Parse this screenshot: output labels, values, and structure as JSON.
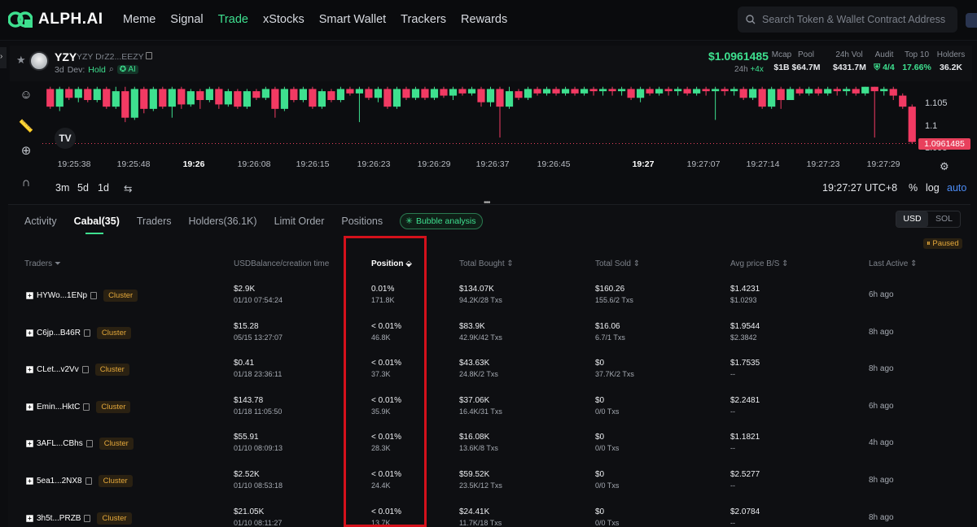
{
  "nav": {
    "logo_text": "ALPH.AI",
    "items": [
      "Meme",
      "Signal",
      "Trade",
      "xStocks",
      "Smart Wallet",
      "Trackers",
      "Rewards"
    ],
    "active_index": 2,
    "search_placeholder": "Search Token & Wallet Contract Address",
    "accent": "#3ee08f"
  },
  "token": {
    "symbol": "YZY",
    "sub_symbol": "YZY",
    "address": "DrZ2...EEZY",
    "age": "3d",
    "dev_label": "Dev:",
    "dev_status": "Hold",
    "ai_label": "AI",
    "price": "$1.0961485",
    "price_period": "24h",
    "price_change": "+4x",
    "stats": [
      {
        "label": "Mcap",
        "value": "$1B"
      },
      {
        "label": "Pool",
        "value": "$64.7M"
      },
      {
        "label": "24h Vol",
        "value": "$431.7M"
      },
      {
        "label": "Audit",
        "value": "4/4"
      },
      {
        "label": "Top 10",
        "value": "17.66%"
      },
      {
        "label": "Holders",
        "value": "36.2K"
      }
    ]
  },
  "chart_data": {
    "type": "candlestick",
    "price_axis_labels": [
      "1.105",
      "1.1",
      "1.095"
    ],
    "current_price_label": "1.0961485",
    "time_labels": [
      {
        "text": "19:25:38",
        "bold": false
      },
      {
        "text": "19:25:48",
        "bold": false
      },
      {
        "text": "19:26",
        "bold": true
      },
      {
        "text": "19:26:08",
        "bold": false
      },
      {
        "text": "19:26:15",
        "bold": false
      },
      {
        "text": "19:26:23",
        "bold": false
      },
      {
        "text": "19:26:29",
        "bold": false
      },
      {
        "text": "19:26:37",
        "bold": false
      },
      {
        "text": "19:26:45",
        "bold": false
      },
      {
        "text": "19:27",
        "bold": true
      },
      {
        "text": "19:27:07",
        "bold": false
      },
      {
        "text": "19:27:14",
        "bold": false
      },
      {
        "text": "19:27:23",
        "bold": false
      },
      {
        "text": "19:27:29",
        "bold": false
      }
    ],
    "candles": [
      {
        "o": 1.1085,
        "c": 1.1045,
        "h": 1.109,
        "l": 1.104
      },
      {
        "o": 1.1045,
        "c": 1.1085,
        "h": 1.109,
        "l": 1.1035
      },
      {
        "o": 1.1085,
        "c": 1.1065,
        "h": 1.109,
        "l": 1.106
      },
      {
        "o": 1.1065,
        "c": 1.1085,
        "h": 1.109,
        "l": 1.1055
      },
      {
        "o": 1.1085,
        "c": 1.106,
        "h": 1.109,
        "l": 1.1055
      },
      {
        "o": 1.106,
        "c": 1.1085,
        "h": 1.109,
        "l": 1.1055
      },
      {
        "o": 1.1085,
        "c": 1.1045,
        "h": 1.109,
        "l": 1.104
      },
      {
        "o": 1.1045,
        "c": 1.108,
        "h": 1.109,
        "l": 1.104
      },
      {
        "o": 1.108,
        "c": 1.102,
        "h": 1.109,
        "l": 1.101
      },
      {
        "o": 1.102,
        "c": 1.1085,
        "h": 1.109,
        "l": 1.1015
      },
      {
        "o": 1.1085,
        "c": 1.104,
        "h": 1.109,
        "l": 1.103
      },
      {
        "o": 1.104,
        "c": 1.1085,
        "h": 1.109,
        "l": 1.1035
      },
      {
        "o": 1.1085,
        "c": 1.1045,
        "h": 1.109,
        "l": 1.104
      },
      {
        "o": 1.1045,
        "c": 1.1085,
        "h": 1.109,
        "l": 1.102
      },
      {
        "o": 1.1085,
        "c": 1.105,
        "h": 1.109,
        "l": 1.104
      },
      {
        "o": 1.105,
        "c": 1.108,
        "h": 1.1085,
        "l": 1.1045
      },
      {
        "o": 1.108,
        "c": 1.106,
        "h": 1.1085,
        "l": 1.104
      },
      {
        "o": 1.106,
        "c": 1.1085,
        "h": 1.109,
        "l": 1.1055
      },
      {
        "o": 1.1085,
        "c": 1.105,
        "h": 1.109,
        "l": 1.104
      },
      {
        "o": 1.105,
        "c": 1.108,
        "h": 1.1085,
        "l": 1.1045
      },
      {
        "o": 1.108,
        "c": 1.1045,
        "h": 1.1085,
        "l": 1.104
      },
      {
        "o": 1.1045,
        "c": 1.108,
        "h": 1.1085,
        "l": 1.104
      },
      {
        "o": 1.108,
        "c": 1.1065,
        "h": 1.1085,
        "l": 1.106
      },
      {
        "o": 1.1065,
        "c": 1.1085,
        "h": 1.109,
        "l": 1.106
      },
      {
        "o": 1.1085,
        "c": 1.104,
        "h": 1.109,
        "l": 1.102
      },
      {
        "o": 1.104,
        "c": 1.1085,
        "h": 1.109,
        "l": 1.1035
      },
      {
        "o": 1.1085,
        "c": 1.106,
        "h": 1.109,
        "l": 1.1055
      },
      {
        "o": 1.106,
        "c": 1.1085,
        "h": 1.109,
        "l": 1.1055
      },
      {
        "o": 1.1085,
        "c": 1.1045,
        "h": 1.109,
        "l": 1.104
      },
      {
        "o": 1.1045,
        "c": 1.108,
        "h": 1.1085,
        "l": 1.104
      },
      {
        "o": 1.108,
        "c": 1.106,
        "h": 1.1085,
        "l": 1.1055
      },
      {
        "o": 1.106,
        "c": 1.1085,
        "h": 1.109,
        "l": 1.1055
      },
      {
        "o": 1.1085,
        "c": 1.1075,
        "h": 1.109,
        "l": 1.107
      },
      {
        "o": 1.1075,
        "c": 1.1085,
        "h": 1.109,
        "l": 1.101
      },
      {
        "o": 1.1085,
        "c": 1.1065,
        "h": 1.109,
        "l": 1.106
      },
      {
        "o": 1.1065,
        "c": 1.1085,
        "h": 1.109,
        "l": 1.1055
      },
      {
        "o": 1.1085,
        "c": 1.1045,
        "h": 1.109,
        "l": 1.104
      },
      {
        "o": 1.1045,
        "c": 1.1085,
        "h": 1.109,
        "l": 1.104
      },
      {
        "o": 1.1085,
        "c": 1.1065,
        "h": 1.109,
        "l": 1.106
      },
      {
        "o": 1.1065,
        "c": 1.1085,
        "h": 1.109,
        "l": 1.106
      },
      {
        "o": 1.1085,
        "c": 1.1065,
        "h": 1.109,
        "l": 1.106
      },
      {
        "o": 1.1065,
        "c": 1.1085,
        "h": 1.109,
        "l": 1.106
      },
      {
        "o": 1.1085,
        "c": 1.107,
        "h": 1.109,
        "l": 1.1065
      },
      {
        "o": 1.107,
        "c": 1.1085,
        "h": 1.109,
        "l": 1.106
      },
      {
        "o": 1.1085,
        "c": 1.1075,
        "h": 1.109,
        "l": 1.107
      },
      {
        "o": 1.1075,
        "c": 1.1085,
        "h": 1.109,
        "l": 1.107
      },
      {
        "o": 1.1085,
        "c": 1.1055,
        "h": 1.109,
        "l": 1.1045
      },
      {
        "o": 1.1055,
        "c": 1.1085,
        "h": 1.109,
        "l": 1.1045
      },
      {
        "o": 1.1085,
        "c": 1.1045,
        "h": 1.109,
        "l": 1.0975
      },
      {
        "o": 1.1045,
        "c": 1.108,
        "h": 1.109,
        "l": 1.104
      },
      {
        "o": 1.108,
        "c": 1.1065,
        "h": 1.1085,
        "l": 1.106
      },
      {
        "o": 1.1065,
        "c": 1.1085,
        "h": 1.109,
        "l": 1.106
      },
      {
        "o": 1.1085,
        "c": 1.1075,
        "h": 1.109,
        "l": 1.107
      },
      {
        "o": 1.1075,
        "c": 1.1085,
        "h": 1.109,
        "l": 1.107
      },
      {
        "o": 1.1085,
        "c": 1.1075,
        "h": 1.109,
        "l": 1.107
      },
      {
        "o": 1.1075,
        "c": 1.1085,
        "h": 1.109,
        "l": 1.107
      },
      {
        "o": 1.1085,
        "c": 1.1075,
        "h": 1.109,
        "l": 1.107
      },
      {
        "o": 1.1075,
        "c": 1.1085,
        "h": 1.109,
        "l": 1.107
      },
      {
        "o": 1.1085,
        "c": 1.108,
        "h": 1.109,
        "l": 1.107
      },
      {
        "o": 1.108,
        "c": 1.1085,
        "h": 1.109,
        "l": 1.107
      },
      {
        "o": 1.1085,
        "c": 1.108,
        "h": 1.109,
        "l": 1.107
      },
      {
        "o": 1.108,
        "c": 1.1085,
        "h": 1.109,
        "l": 1.107
      },
      {
        "o": 1.1085,
        "c": 1.1065,
        "h": 1.109,
        "l": 1.106
      },
      {
        "o": 1.1065,
        "c": 1.1085,
        "h": 1.109,
        "l": 1.1055
      },
      {
        "o": 1.1085,
        "c": 1.1075,
        "h": 1.109,
        "l": 1.107
      },
      {
        "o": 1.1075,
        "c": 1.1085,
        "h": 1.109,
        "l": 1.107
      },
      {
        "o": 1.1085,
        "c": 1.108,
        "h": 1.109,
        "l": 1.107
      },
      {
        "o": 1.108,
        "c": 1.1085,
        "h": 1.109,
        "l": 1.107
      },
      {
        "o": 1.1085,
        "c": 1.1075,
        "h": 1.109,
        "l": 1.107
      },
      {
        "o": 1.1075,
        "c": 1.1085,
        "h": 1.109,
        "l": 1.107
      },
      {
        "o": 1.1085,
        "c": 1.108,
        "h": 1.109,
        "l": 1.107
      },
      {
        "o": 1.108,
        "c": 1.1085,
        "h": 1.109,
        "l": 1.1015
      },
      {
        "o": 1.1085,
        "c": 1.108,
        "h": 1.109,
        "l": 1.107
      },
      {
        "o": 1.108,
        "c": 1.1085,
        "h": 1.109,
        "l": 1.107
      },
      {
        "o": 1.1085,
        "c": 1.1065,
        "h": 1.109,
        "l": 1.106
      },
      {
        "o": 1.1065,
        "c": 1.1085,
        "h": 1.109,
        "l": 1.106
      },
      {
        "o": 1.1085,
        "c": 1.1045,
        "h": 1.109,
        "l": 1.104
      },
      {
        "o": 1.1045,
        "c": 1.1085,
        "h": 1.109,
        "l": 1.104
      },
      {
        "o": 1.1085,
        "c": 1.106,
        "h": 1.109,
        "l": 1.104
      },
      {
        "o": 1.106,
        "c": 1.1085,
        "h": 1.109,
        "l": 1.106
      },
      {
        "o": 1.1085,
        "c": 1.1075,
        "h": 1.109,
        "l": 1.107
      },
      {
        "o": 1.1075,
        "c": 1.1085,
        "h": 1.109,
        "l": 1.107
      },
      {
        "o": 1.1085,
        "c": 1.1075,
        "h": 1.109,
        "l": 1.107
      },
      {
        "o": 1.1075,
        "c": 1.1085,
        "h": 1.109,
        "l": 1.107
      },
      {
        "o": 1.1085,
        "c": 1.108,
        "h": 1.109,
        "l": 1.107
      },
      {
        "o": 1.108,
        "c": 1.1085,
        "h": 1.109,
        "l": 1.107
      },
      {
        "o": 1.1085,
        "c": 1.1075,
        "h": 1.109,
        "l": 1.107
      },
      {
        "o": 1.1075,
        "c": 1.109,
        "h": 1.109,
        "l": 1.107
      },
      {
        "o": 1.109,
        "c": 1.108,
        "h": 1.109,
        "l": 1.0975
      },
      {
        "o": 1.108,
        "c": 1.1085,
        "h": 1.109,
        "l": 1.107
      },
      {
        "o": 1.1085,
        "c": 1.107,
        "h": 1.109,
        "l": 1.106
      },
      {
        "o": 1.107,
        "c": 1.1045,
        "h": 1.1075,
        "l": 1.104
      },
      {
        "o": 1.1045,
        "c": 1.0965,
        "h": 1.105,
        "l": 1.0961
      }
    ]
  },
  "chart_controls": {
    "ranges": [
      "3m",
      "5d",
      "1d"
    ],
    "clock": "19:27:27 UTC+8",
    "percent": "%",
    "log": "log",
    "auto": "auto",
    "tv_logo": "TV"
  },
  "tabs": [
    {
      "label": "Activity",
      "active": false
    },
    {
      "label": "Cabal(35)",
      "active": true
    },
    {
      "label": "Traders",
      "active": false
    },
    {
      "label": "Holders(36.1K)",
      "active": false
    },
    {
      "label": "Limit Order",
      "active": false
    },
    {
      "label": "Positions",
      "active": false
    }
  ],
  "bubble_label": "Bubble analysis",
  "currency": [
    "USD",
    "SOL"
  ],
  "currency_selected": "USD",
  "paused_label": "Paused",
  "columns": [
    {
      "label": "Traders",
      "sort": false
    },
    {
      "label": "USDBalance/creation time",
      "sort": false
    },
    {
      "label": "Position",
      "sort": true
    },
    {
      "label": "Total Bought",
      "sort": false
    },
    {
      "label": "Total Sold",
      "sort": false
    },
    {
      "label": "Avg price B/S",
      "sort": false
    },
    {
      "label": "Last Active",
      "sort": false
    }
  ],
  "cluster_label": "Cluster",
  "rows": [
    {
      "trader": "HYWo...1ENp",
      "bal": "$2.9K",
      "created": "01/10 07:54:24",
      "pos": "0.01%",
      "pos_amt": "171.8K",
      "bought": "$134.07K",
      "bought_sub": "94.2K/28 Txs",
      "sold": "$160.26",
      "sold_sub": "155.6/2 Txs",
      "avg_b": "$1.4231",
      "avg_s": "$1.0293",
      "last": "6h ago"
    },
    {
      "trader": "C6jp...B46R",
      "bal": "$15.28",
      "created": "05/15 13:27:07",
      "pos": "< 0.01%",
      "pos_amt": "46.8K",
      "bought": "$83.9K",
      "bought_sub": "42.9K/42 Txs",
      "sold": "$16.06",
      "sold_sub": "6.7/1 Txs",
      "avg_b": "$1.9544",
      "avg_s": "$2.3842",
      "last": "8h ago"
    },
    {
      "trader": "CLet...v2Vv",
      "bal": "$0.41",
      "created": "01/18 23:36:11",
      "pos": "< 0.01%",
      "pos_amt": "37.3K",
      "bought": "$43.63K",
      "bought_sub": "24.8K/2 Txs",
      "sold": "$0",
      "sold_sub": "37.7K/2 Txs",
      "avg_b": "$1.7535",
      "avg_s": "--",
      "last": "8h ago"
    },
    {
      "trader": "Emin...HktC",
      "bal": "$143.78",
      "created": "01/18 11:05:50",
      "pos": "< 0.01%",
      "pos_amt": "35.9K",
      "bought": "$37.06K",
      "bought_sub": "16.4K/31 Txs",
      "sold": "$0",
      "sold_sub": "0/0 Txs",
      "avg_b": "$2.2481",
      "avg_s": "--",
      "last": "6h ago"
    },
    {
      "trader": "3AFL...CBhs",
      "bal": "$55.91",
      "created": "01/10 08:09:13",
      "pos": "< 0.01%",
      "pos_amt": "28.3K",
      "bought": "$16.08K",
      "bought_sub": "13.6K/8 Txs",
      "sold": "$0",
      "sold_sub": "0/0 Txs",
      "avg_b": "$1.1821",
      "avg_s": "--",
      "last": "4h ago"
    },
    {
      "trader": "5ea1...2NX8",
      "bal": "$2.52K",
      "created": "01/10 08:53:18",
      "pos": "< 0.01%",
      "pos_amt": "24.4K",
      "bought": "$59.52K",
      "bought_sub": "23.5K/12 Txs",
      "sold": "$0",
      "sold_sub": "0/0 Txs",
      "avg_b": "$2.5277",
      "avg_s": "--",
      "last": "8h ago"
    },
    {
      "trader": "3h5t...PRZB",
      "bal": "$21.05K",
      "created": "01/10 08:11:27",
      "pos": "< 0.01%",
      "pos_amt": "13.7K",
      "bought": "$24.41K",
      "bought_sub": "11.7K/18 Txs",
      "sold": "$0",
      "sold_sub": "0/0 Txs",
      "avg_b": "$2.0784",
      "avg_s": "--",
      "last": "8h ago"
    }
  ],
  "colors": {
    "up": "#3ee08f",
    "down": "#f23a63",
    "highlight": "#d4111b",
    "cluster": "#e4a83a"
  }
}
